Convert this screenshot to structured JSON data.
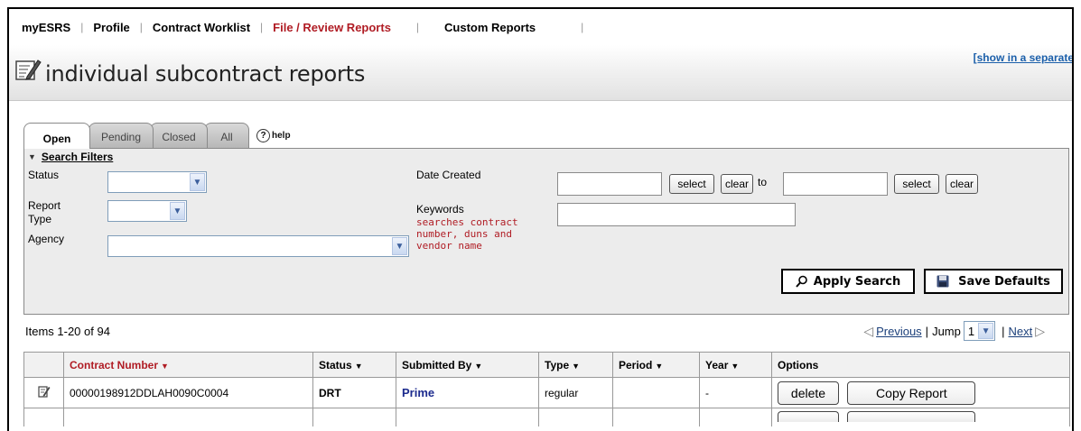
{
  "nav": {
    "items": [
      {
        "label": "myESRS"
      },
      {
        "label": "Profile"
      },
      {
        "label": "Contract Worklist"
      },
      {
        "label": "File / Review Reports"
      },
      {
        "label": "Custom Reports"
      }
    ],
    "active_color": "#b01c24"
  },
  "header": {
    "title": "individual subcontract reports",
    "icon": "edit-document-icon",
    "separate_window_link": "[show in a separate windo"
  },
  "tabs": {
    "items": [
      {
        "label": "Open"
      },
      {
        "label": "Pending"
      },
      {
        "label": "Closed"
      },
      {
        "label": "All"
      }
    ],
    "help_label": "help",
    "help_glyph": "?"
  },
  "filters": {
    "heading": "Search Filters",
    "status_label": "Status",
    "report_type_label": "Report Type",
    "agency_label": "Agency",
    "date_created_label": "Date Created",
    "select_label": "select",
    "clear_label": "clear",
    "to_label": "to",
    "keywords_label": "Keywords",
    "keywords_hint": "searches contract number, duns and vendor name",
    "apply_label": "Apply Search",
    "save_defaults_label": "Save Defaults"
  },
  "pager": {
    "items_text": "Items 1-20 of 94",
    "previous": "Previous",
    "jump_label": "Jump",
    "jump_value": "1",
    "next": "Next"
  },
  "table": {
    "headers": {
      "contract_number": "Contract Number",
      "status": "Status",
      "submitted_by": "Submitted By",
      "type": "Type",
      "period": "Period",
      "year": "Year",
      "options": "Options"
    },
    "rows": [
      {
        "contract_number": "00000198912DDLAH0090C0004",
        "status": "DRT",
        "submitted_by": "Prime",
        "type": "regular",
        "period": "",
        "year": "-",
        "delete_label": "delete",
        "copy_label": "Copy Report"
      }
    ]
  }
}
